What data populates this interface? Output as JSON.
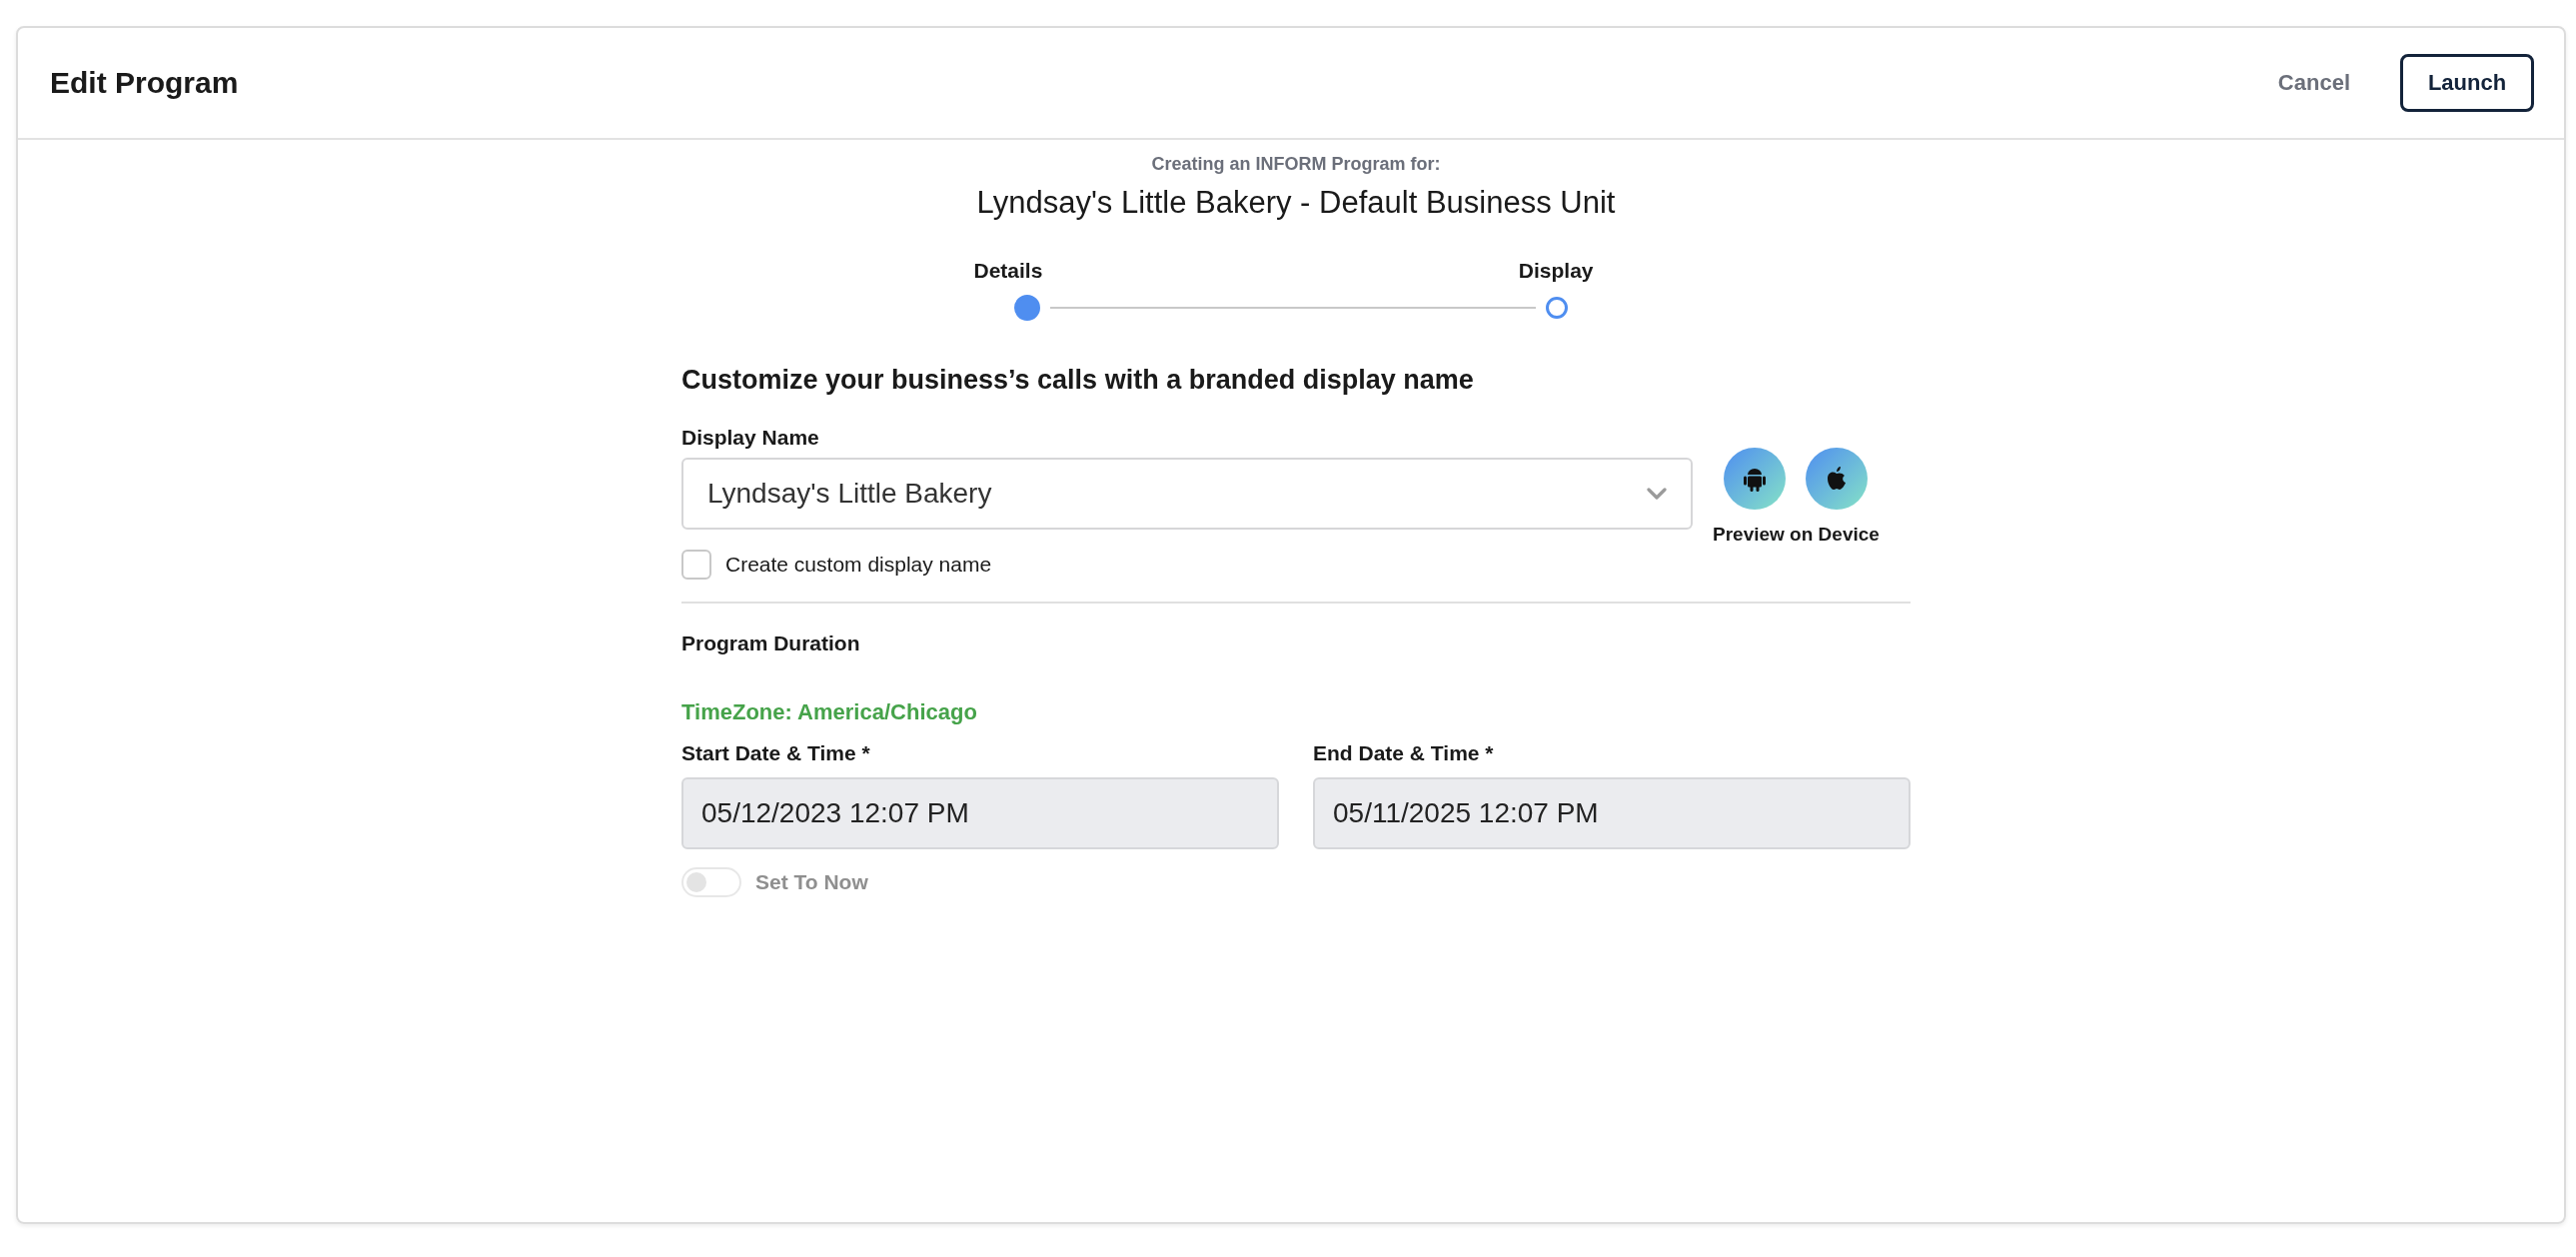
{
  "header": {
    "title": "Edit Program",
    "cancel": "Cancel",
    "launch": "Launch"
  },
  "intro": {
    "subtitle": "Creating an INFORM Program for:",
    "business": "Lyndsay's Little Bakery - Default Business Unit"
  },
  "steps": [
    {
      "label": "Details",
      "selected": true
    },
    {
      "label": "Display",
      "selected": false
    }
  ],
  "heading": "Customize your business’s calls with a branded display name",
  "display_name": {
    "label": "Display Name",
    "value": "Lyndsay's Little Bakery"
  },
  "preview": {
    "label": "Preview on Device"
  },
  "custom_name": {
    "label": "Create custom display name",
    "checked": false
  },
  "duration": {
    "title": "Program Duration",
    "timezone": "TimeZone: America/Chicago",
    "start": {
      "label": "Start Date & Time *",
      "value": "05/12/2023 12:07 PM"
    },
    "end": {
      "label": "End Date & Time *",
      "value": "05/11/2025 12:07 PM"
    },
    "set_to_now": {
      "label": "Set To Now",
      "on": false,
      "disabled": true
    }
  }
}
